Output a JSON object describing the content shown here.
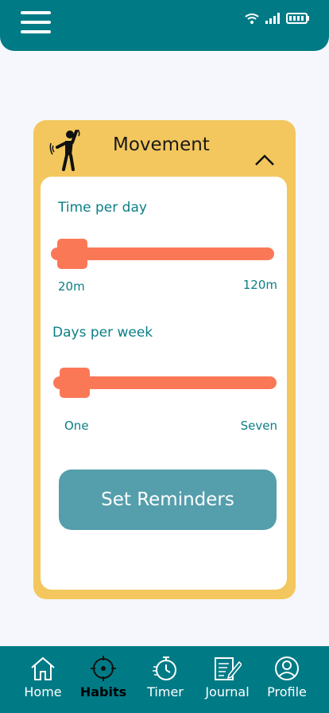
{
  "header": {
    "menu_icon": "hamburger-icon",
    "status_icons": [
      "wifi-icon",
      "signal-icon",
      "battery-icon"
    ]
  },
  "card": {
    "title": "Movement",
    "collapse_icon": "chevron-up-icon",
    "time": {
      "label": "Time per day",
      "min_label": "20m",
      "max_label": "120m",
      "value_fraction": 0.0
    },
    "days": {
      "label": "Days per week",
      "min_label": "One",
      "max_label": "Seven",
      "value_fraction": 0.0
    },
    "button": "Set Reminders"
  },
  "nav": [
    {
      "label": "Home",
      "icon": "home-icon",
      "active": false
    },
    {
      "label": "Habits",
      "icon": "target-icon",
      "active": true
    },
    {
      "label": "Timer",
      "icon": "stopwatch-icon",
      "active": false
    },
    {
      "label": "Journal",
      "icon": "journal-icon",
      "active": false
    },
    {
      "label": "Profile",
      "icon": "profile-icon",
      "active": false
    }
  ],
  "colors": {
    "teal": "#007b86",
    "yellow": "#f3c75d",
    "coral": "#fb7857",
    "button": "#559eac"
  }
}
